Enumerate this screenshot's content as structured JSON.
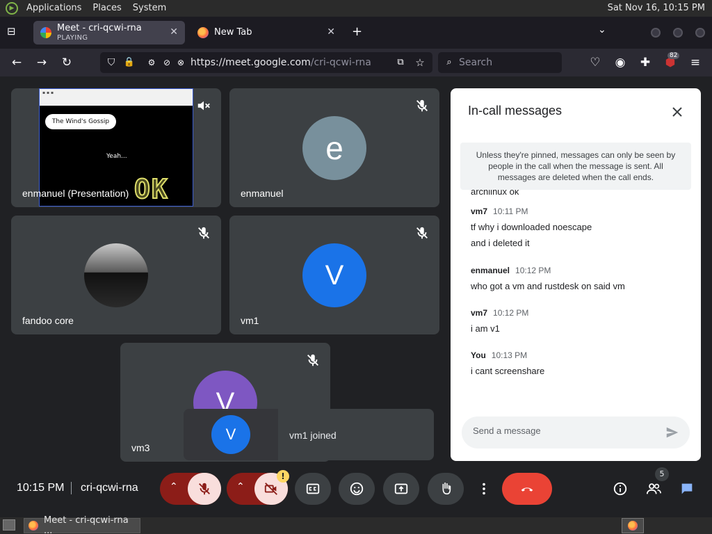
{
  "top_panel": {
    "menus": [
      "Applications",
      "Places",
      "System"
    ],
    "clock": "Sat Nov 16, 10:15 PM"
  },
  "browser": {
    "tabs": [
      {
        "title": "Meet - cri-qcwi-rna",
        "subtitle": "PLAYING",
        "active": true
      },
      {
        "title": "New Tab",
        "subtitle": "",
        "active": false
      }
    ],
    "url_host": "https://meet.google.com",
    "url_path": "/cri-qcwi-rna",
    "search_placeholder": "Search",
    "extension_badge": "82"
  },
  "meet": {
    "tiles": [
      {
        "name": "enmanuel (Presentation)",
        "type": "presentation",
        "muted": true
      },
      {
        "name": "enmanuel",
        "avatar_letter": "e",
        "avatar_color": "#78909c",
        "muted": true
      },
      {
        "name": "fandoo core",
        "type": "photo",
        "muted": true
      },
      {
        "name": "vm1",
        "avatar_letter": "V",
        "avatar_color": "#1a73e8",
        "muted": true
      },
      {
        "name": "vm3",
        "avatar_letter": "V",
        "avatar_color": "#7e57c2",
        "muted": true
      }
    ],
    "presentation": {
      "bubble_text": "The Wind's Gossip",
      "caption": "Yeah...",
      "overlay_text": "OK"
    },
    "toast": {
      "avatar_letter": "V",
      "avatar_color": "#1a73e8",
      "text": "vm1 joined"
    }
  },
  "chat": {
    "title": "In-call messages",
    "notice": "Unless they're pinned, messages can only be seen by people in the call when the message is sent. All messages are deleted when the call ends.",
    "partial_line": "archlinux ok",
    "messages": [
      {
        "sender": "vm7",
        "time": "10:11 PM",
        "lines": [
          "tf why i downloaded noescape",
          "and i deleted it"
        ]
      },
      {
        "sender": "enmanuel",
        "time": "10:12 PM",
        "lines": [
          "who got a vm and rustdesk on said vm"
        ]
      },
      {
        "sender": "vm7",
        "time": "10:12 PM",
        "lines": [
          "i am v1"
        ]
      },
      {
        "sender": "You",
        "time": "10:13 PM",
        "lines": [
          "i cant screenshare"
        ]
      }
    ],
    "input_placeholder": "Send a message"
  },
  "controls": {
    "time": "10:15 PM",
    "meeting_code": "cri-qcwi-rna",
    "camera_warning": "!",
    "participants_count": "5",
    "colors": {
      "mic_off_bg": "#f9dedc",
      "alert_red": "#8c1d18",
      "end_call": "#ea4335",
      "active_icon": "#8ab4f8",
      "ctrl_bg": "#3c4043"
    }
  },
  "taskbar": {
    "window_title": "Meet - cri-qcwi-rna ..."
  }
}
